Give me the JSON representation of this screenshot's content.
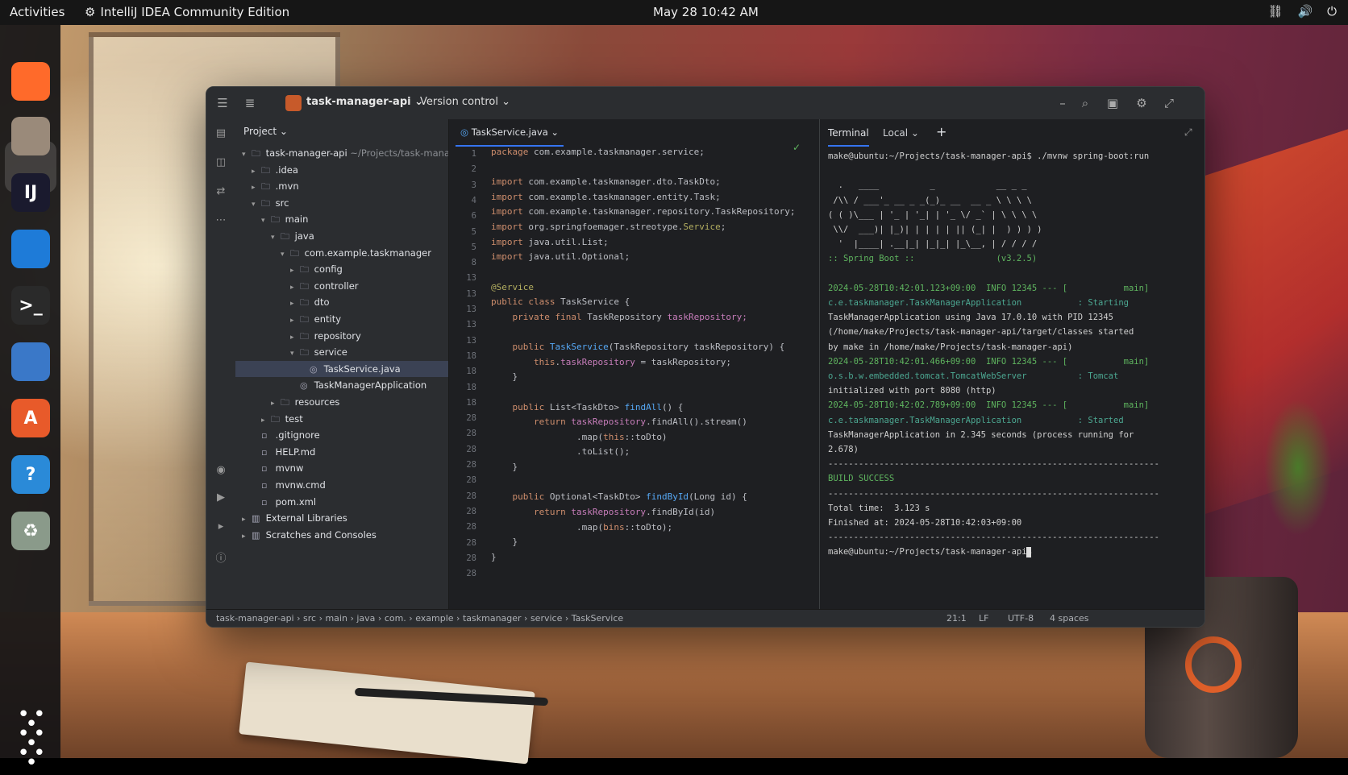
{
  "topbar": {
    "activities": "Activities",
    "app_name": "IntelliJ IDEA Community Edition",
    "clock": "May 28  10:42 AM"
  },
  "dock": {
    "items": [
      {
        "name": "firefox-icon",
        "glyph": "",
        "color": "#ff6a2a"
      },
      {
        "name": "files-icon",
        "glyph": "",
        "color": "#9a8a7a"
      },
      {
        "name": "intellij-icon",
        "glyph": "IJ",
        "color": "#1a1a2e"
      },
      {
        "name": "vscode-icon",
        "glyph": "",
        "color": "#1e7bd8"
      },
      {
        "name": "terminal-icon",
        "glyph": ">_",
        "color": "#2a2a2a"
      },
      {
        "name": "writer-icon",
        "glyph": "",
        "color": "#3a78c8"
      },
      {
        "name": "app-center-icon",
        "glyph": "A",
        "color": "#e85a2a"
      },
      {
        "name": "help-icon",
        "glyph": "?",
        "color": "#2a8ad8"
      },
      {
        "name": "trash-icon",
        "glyph": "♻",
        "color": "#8a9a8a"
      }
    ]
  },
  "ide": {
    "project_name": "task-manager-api",
    "version_control": "Version control",
    "project_panel_title": "Project",
    "tree": [
      {
        "label": "task-manager-api",
        "extra": "~/Projects/task-manager-api",
        "depth": 0,
        "arrow": "v",
        "icon": "folder"
      },
      {
        "label": ".idea",
        "depth": 1,
        "arrow": ">",
        "icon": "folder"
      },
      {
        "label": ".mvn",
        "depth": 1,
        "arrow": ">",
        "icon": "folder"
      },
      {
        "label": "src",
        "depth": 1,
        "arrow": "v",
        "icon": "folder"
      },
      {
        "label": "main",
        "depth": 2,
        "arrow": "v",
        "icon": "folder"
      },
      {
        "label": "java",
        "depth": 3,
        "arrow": "v",
        "icon": "folder"
      },
      {
        "label": "com.example.taskmanager",
        "depth": 4,
        "arrow": "v",
        "icon": "folder"
      },
      {
        "label": "config",
        "depth": 5,
        "arrow": ">",
        "icon": "folder"
      },
      {
        "label": "controller",
        "depth": 5,
        "arrow": ">",
        "icon": "folder"
      },
      {
        "label": "dto",
        "depth": 5,
        "arrow": ">",
        "icon": "folder"
      },
      {
        "label": "entity",
        "depth": 5,
        "arrow": ">",
        "icon": "folder"
      },
      {
        "label": "repository",
        "depth": 5,
        "arrow": ">",
        "icon": "folder"
      },
      {
        "label": "service",
        "depth": 5,
        "arrow": "v",
        "icon": "folder"
      },
      {
        "label": "TaskService.java",
        "depth": 6,
        "arrow": "",
        "icon": "java",
        "selected": true
      },
      {
        "label": "TaskManagerApplication",
        "depth": 5,
        "arrow": "",
        "icon": "java"
      },
      {
        "label": "resources",
        "depth": 3,
        "arrow": ">",
        "icon": "folder"
      },
      {
        "label": "test",
        "depth": 2,
        "arrow": ">",
        "icon": "folder"
      },
      {
        "label": ".gitignore",
        "depth": 1,
        "arrow": "",
        "icon": "file"
      },
      {
        "label": "HELP.md",
        "depth": 1,
        "arrow": "",
        "icon": "file"
      },
      {
        "label": "mvnw",
        "depth": 1,
        "arrow": "",
        "icon": "file"
      },
      {
        "label": "mvnw.cmd",
        "depth": 1,
        "arrow": "",
        "icon": "file"
      },
      {
        "label": "pom.xml",
        "depth": 1,
        "arrow": "",
        "icon": "file"
      },
      {
        "label": "External Libraries",
        "depth": 0,
        "arrow": ">",
        "icon": "lib"
      },
      {
        "label": "Scratches and Consoles",
        "depth": 0,
        "arrow": ">",
        "icon": "lib"
      }
    ],
    "editor_tab": "TaskService.java",
    "line_numbers": [
      "1",
      "2",
      "3",
      "4",
      "6",
      "5",
      "5",
      "8",
      "13",
      "13",
      "13",
      "13",
      "13",
      "18",
      "18",
      "18",
      "18",
      "28",
      "28",
      "28",
      "28",
      "28",
      "28",
      "28",
      "28",
      "28",
      "28",
      "28"
    ],
    "code": [
      [
        {
          "t": "package ",
          "c": "kw"
        },
        {
          "t": "com.example.taskmanager.service;",
          "c": ""
        }
      ],
      [],
      [
        {
          "t": "import ",
          "c": "kw"
        },
        {
          "t": "com.example.taskmanager.dto.TaskDto;",
          "c": ""
        }
      ],
      [
        {
          "t": "import ",
          "c": "kw"
        },
        {
          "t": "com.example.taskmanager.entity.Task;",
          "c": ""
        }
      ],
      [
        {
          "t": "import ",
          "c": "kw"
        },
        {
          "t": "com.example.taskmanager.repository.TaskRepository;",
          "c": ""
        }
      ],
      [
        {
          "t": "import ",
          "c": "kw"
        },
        {
          "t": "org.springfoemager.streotype.",
          "c": ""
        },
        {
          "t": "Service",
          "c": "an"
        },
        {
          "t": ";",
          "c": ""
        }
      ],
      [
        {
          "t": "import ",
          "c": "kw"
        },
        {
          "t": "java.util.List;",
          "c": ""
        }
      ],
      [
        {
          "t": "import ",
          "c": "kw"
        },
        {
          "t": "java.util.Optional;",
          "c": ""
        }
      ],
      [
        {
          "t": "@Service",
          "c": "an"
        }
      ],
      [
        {
          "t": "public class ",
          "c": "kw"
        },
        {
          "t": "TaskService {",
          "c": ""
        }
      ],
      [
        {
          "t": "    private final ",
          "c": "kw"
        },
        {
          "t": "TaskRepository ",
          "c": ""
        },
        {
          "t": "taskRepository;",
          "c": "fld"
        }
      ],
      [
        {
          "t": "",
          "c": ""
        }
      ],
      [
        {
          "t": "    public ",
          "c": "kw"
        },
        {
          "t": "TaskService",
          "c": "fn"
        },
        {
          "t": "(TaskRepository taskRepository) {",
          "c": ""
        }
      ],
      [
        {
          "t": "        this",
          "c": "kw"
        },
        {
          "t": ".",
          "c": ""
        },
        {
          "t": "taskRepository",
          "c": "fld"
        },
        {
          "t": " = taskRepository;",
          "c": ""
        }
      ],
      [
        {
          "t": "    }",
          "c": ""
        }
      ],
      [],
      [
        {
          "t": "    public ",
          "c": "kw"
        },
        {
          "t": "List<TaskDto> ",
          "c": ""
        },
        {
          "t": "findAll",
          "c": "fn"
        },
        {
          "t": "() {",
          "c": ""
        }
      ],
      [
        {
          "t": "        return ",
          "c": "kw"
        },
        {
          "t": "taskRepository",
          "c": "fld"
        },
        {
          "t": ".findAll().stream()",
          "c": ""
        }
      ],
      [
        {
          "t": "                .map(",
          "c": ""
        },
        {
          "t": "this",
          "c": "kw"
        },
        {
          "t": "::toDto)",
          "c": ""
        }
      ],
      [
        {
          "t": "                .toList();",
          "c": ""
        }
      ],
      [
        {
          "t": "    }",
          "c": ""
        }
      ],
      [],
      [
        {
          "t": "    public ",
          "c": "kw"
        },
        {
          "t": "Optional<TaskDto> ",
          "c": ""
        },
        {
          "t": "findById",
          "c": "fn"
        },
        {
          "t": "(Long id) {",
          "c": ""
        }
      ],
      [
        {
          "t": "        return ",
          "c": "kw"
        },
        {
          "t": "taskRepository",
          "c": "fld"
        },
        {
          "t": ".findById(id)",
          "c": ""
        }
      ],
      [
        {
          "t": "                .map(",
          "c": ""
        },
        {
          "t": "bins",
          "c": "kw"
        },
        {
          "t": "::toDto);",
          "c": ""
        }
      ],
      [
        {
          "t": "    }",
          "c": ""
        }
      ],
      [
        {
          "t": "}",
          "c": ""
        }
      ]
    ],
    "terminal": {
      "tab_terminal": "Terminal",
      "tab_local": "Local",
      "lines": [
        {
          "t": "make@ubuntu:~/Projects/task-manager-api$ ./mvnw spring-boot:run",
          "c": ""
        },
        {
          "t": "",
          "c": ""
        },
        {
          "t": "  .   ____          _            __ _ _",
          "c": ""
        },
        {
          "t": " /\\\\ / ___'_ __ _ _(_)_ __  __ _ \\ \\ \\ \\",
          "c": ""
        },
        {
          "t": "( ( )\\___ | '_ | '_| | '_ \\/ _` | \\ \\ \\ \\",
          "c": ""
        },
        {
          "t": " \\\\/  ___)| |_)| | | | | || (_| |  ) ) ) )",
          "c": ""
        },
        {
          "t": "  '  |____| .__|_| |_|_| |_\\__, | / / / /",
          "c": ""
        },
        {
          "t": ":: Spring Boot ::                (v3.2.5)",
          "c": "green"
        },
        {
          "t": "",
          "c": ""
        },
        {
          "t": "2024-05-28T10:42:01.123+09:00  INFO 12345 --- [           main]",
          "c": "green"
        },
        {
          "t": "c.e.taskmanager.TaskManagerApplication           : Starting",
          "c": "teal"
        },
        {
          "t": "TaskManagerApplication using Java 17.0.10 with PID 12345",
          "c": ""
        },
        {
          "t": "(/home/make/Projects/task-manager-api/target/classes started",
          "c": ""
        },
        {
          "t": "by make in /home/make/Projects/task-manager-api)",
          "c": ""
        },
        {
          "t": "2024-05-28T10:42:01.466+09:00  INFO 12345 --- [           main]",
          "c": "green"
        },
        {
          "t": "o.s.b.w.embedded.tomcat.TomcatWebServer          : Tomcat",
          "c": "teal"
        },
        {
          "t": "initialized with port 8080 (http)",
          "c": ""
        },
        {
          "t": "2024-05-28T10:42:02.789+09:00  INFO 12345 --- [           main]",
          "c": "green"
        },
        {
          "t": "c.e.taskmanager.TaskManagerApplication           : Started",
          "c": "teal"
        },
        {
          "t": "TaskManagerApplication in 2.345 seconds (process running for",
          "c": ""
        },
        {
          "t": "2.678)",
          "c": ""
        },
        {
          "t": "-----------------------------------------------------------------",
          "c": ""
        },
        {
          "t": "BUILD SUCCESS",
          "c": "green"
        },
        {
          "t": "-----------------------------------------------------------------",
          "c": ""
        },
        {
          "t": "Total time:  3.123 s",
          "c": ""
        },
        {
          "t": "Finished at: 2024-05-28T10:42:03+09:00",
          "c": ""
        },
        {
          "t": "-----------------------------------------------------------------",
          "c": ""
        },
        {
          "t": "make@ubuntu:~/Projects/task-manager-api$ ",
          "c": ""
        }
      ]
    },
    "status": {
      "breadcrumb": [
        "task-manager-api",
        "src",
        "main",
        "java",
        "com.",
        "example",
        "taskmanager",
        "service",
        "TaskService"
      ],
      "position": "21:1",
      "line_sep": "LF",
      "encoding": "UTF-8",
      "indent": "4 spaces"
    }
  }
}
